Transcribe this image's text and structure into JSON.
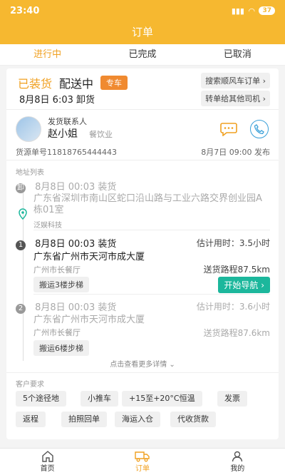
{
  "status": {
    "time": "23:40",
    "battery": "37"
  },
  "title": "订单",
  "tabs": [
    "进行中",
    "已完成",
    "已取消"
  ],
  "order": {
    "status": "已装货",
    "state": "配送中",
    "type_tag": "专车",
    "time_line": "8月8日 6:03 卸货",
    "btn_search": "搜索顺风车订单",
    "btn_transfer": "转单给其他司机",
    "contact_label": "发货联系人",
    "contact_name": "赵小姐",
    "contact_industry": "餐饮业",
    "source_no": "货源单号11818765444443",
    "publish": "8月7日 09:00 发布"
  },
  "address": {
    "header": "地址列表",
    "origin": {
      "title": "8月8日 00:03 装货",
      "addr": "广东省深圳市南山区蛇口沿山路与工业六路交界创业园A栋01室",
      "company": "泛娱科技"
    },
    "stops": [
      {
        "num": "1",
        "title": "8月8日 00:03 装货",
        "est": "估计用时：3.5小时",
        "addr": "广东省广州市天河市成大厦",
        "company": "广州市长餐厅",
        "dist": "送货路程87.5km",
        "tag": "搬运3楼步梯",
        "nav": "开始导航"
      },
      {
        "num": "2",
        "title": "8月8日 00:03 装货",
        "est": "估计用时：3.6小时",
        "addr": "广东省广州市天河市成大厦",
        "company": "广州市长餐厅",
        "dist": "送货路程87.6km",
        "tag": "搬运6楼步梯"
      }
    ],
    "more": "点击查看更多详情"
  },
  "requirements": {
    "header": "客户要求",
    "items": [
      "5个途径地",
      "小推车",
      "+15至+20°C恒温",
      "发票",
      "返程",
      "拍照回单",
      "海运入仓",
      "代收货款"
    ]
  },
  "bottom_nav": [
    "首页",
    "订单",
    "我的"
  ],
  "colors": {
    "accent": "#f6b830",
    "nav_green": "#1cb79c",
    "tag_orange": "#f08a30"
  }
}
